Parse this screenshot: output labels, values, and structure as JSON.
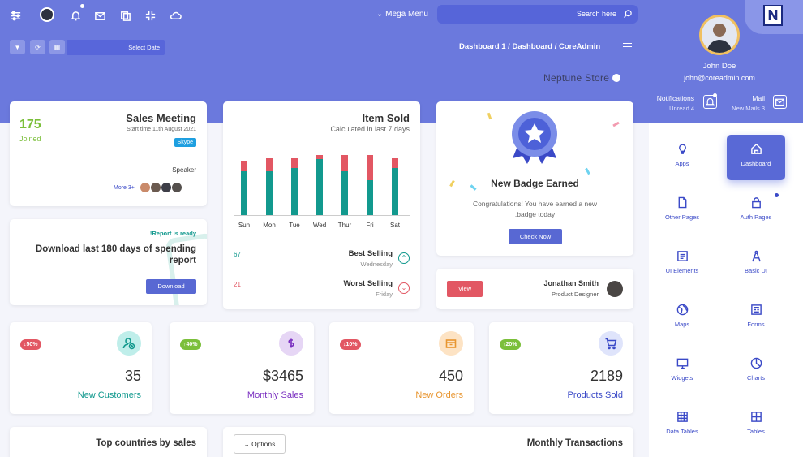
{
  "topbar": {
    "mega_menu": "Mega Menu",
    "search_placeholder": "Search here",
    "date_label": "Select Date",
    "breadcrumb": "Dashboard 1 / Dashboard / CoreAdmin",
    "store": "Neptune Store"
  },
  "profile": {
    "name": "John Doe",
    "email": "john@coreadmin.com",
    "notifications_title": "Notifications",
    "notifications_sub": "Unread 4",
    "mail_title": "Mail",
    "mail_sub": "New Mails 3"
  },
  "meeting": {
    "count": "175",
    "joined": "Joined",
    "title": "Sales Meeting",
    "start": "Start time 11th August 2021",
    "tag": "Skype",
    "speaker": "Speaker",
    "more": "More 3+"
  },
  "report": {
    "ready": "!Report is ready",
    "title": "Download last 180 days of spending report",
    "button": "Download"
  },
  "item_sold": {
    "title": "Item Sold",
    "subtitle": "Calculated in last 7 days",
    "best_value": "67",
    "best_label": "Best Selling",
    "best_day": "Wednesday",
    "worst_value": "21",
    "worst_label": "Worst Selling",
    "worst_day": "Friday"
  },
  "chart_data": {
    "type": "bar",
    "categories": [
      "Sun",
      "Mon",
      "Tue",
      "Wed",
      "Thur",
      "Fri",
      "Sat"
    ],
    "series": [
      {
        "values": [
          73,
          73,
          78,
          93,
          73,
          58,
          78
        ]
      },
      {
        "values": [
          17,
          22,
          17,
          7,
          27,
          42,
          17
        ]
      }
    ],
    "ylim": [
      0,
      100
    ],
    "colors": [
      "#12998e",
      "#e25763"
    ],
    "grid": false
  },
  "badge": {
    "title": "New Badge Earned",
    "text1": "Congratulations! You have earned a new",
    "text2": ".badge today",
    "button": "Check Now"
  },
  "person": {
    "button": "View",
    "name": "Jonathan Smith",
    "role": "Product Designer"
  },
  "stats": [
    {
      "badge": "↓50%",
      "badge_color": "#e25763",
      "value": "35",
      "label": "New Customers",
      "color": "#12998e",
      "icon": "user-plus-icon"
    },
    {
      "badge": "↑40%",
      "badge_color": "#7bbf3a",
      "value": "$3465",
      "label": "Monthly Sales",
      "color": "#7a2fc0",
      "icon": "dollar-icon"
    },
    {
      "badge": "↓10%",
      "badge_color": "#e25763",
      "value": "450",
      "label": "New Orders",
      "color": "#e8952f",
      "icon": "box-icon"
    },
    {
      "badge": "↑20%",
      "badge_color": "#7bbf3a",
      "value": "2189",
      "label": "Products Sold",
      "color": "#3a49c7",
      "icon": "cart-icon"
    }
  ],
  "bottom": {
    "countries": "Top countries by sales",
    "options": "Options",
    "transactions": "Monthly Transactions"
  },
  "sidebar": {
    "items": [
      {
        "label": "Apps",
        "icon": "bulb-icon"
      },
      {
        "label": "Dashboard",
        "icon": "home-icon"
      },
      {
        "label": "Other Pages",
        "icon": "file-icon"
      },
      {
        "label": "Auth Pages",
        "icon": "lock-icon"
      },
      {
        "label": "UI Elements",
        "icon": "list-icon"
      },
      {
        "label": "Basic UI",
        "icon": "compass-icon"
      },
      {
        "label": "Maps",
        "icon": "globe-icon"
      },
      {
        "label": "Forms",
        "icon": "form-icon"
      },
      {
        "label": "Widgets",
        "icon": "monitor-icon"
      },
      {
        "label": "Charts",
        "icon": "pie-icon"
      },
      {
        "label": "Data Tables",
        "icon": "table-icon"
      },
      {
        "label": "Tables",
        "icon": "grid-icon"
      }
    ]
  }
}
